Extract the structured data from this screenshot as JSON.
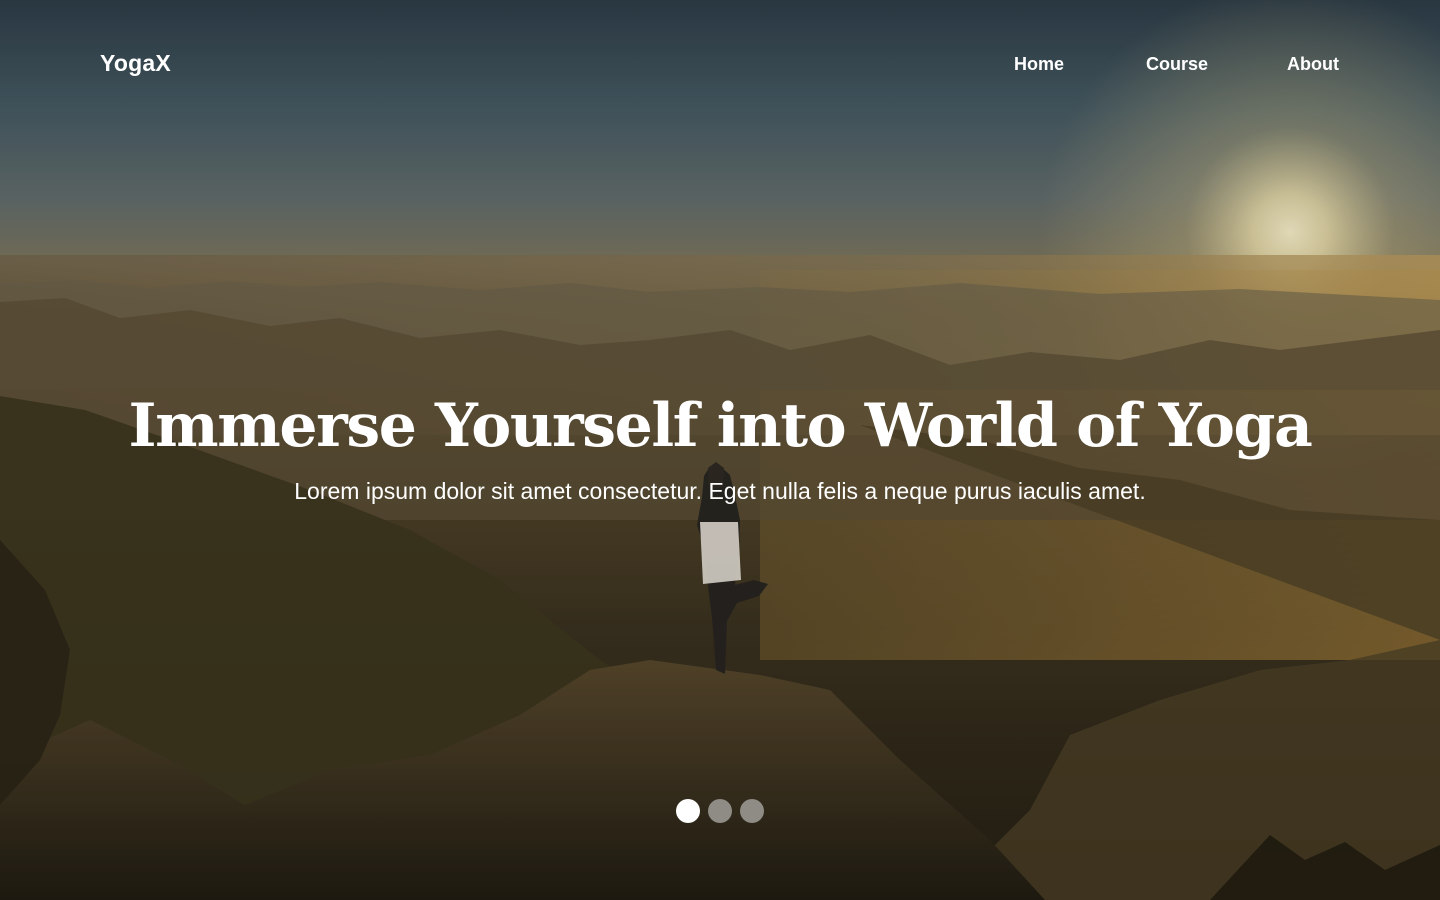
{
  "brand": {
    "name": "YogaX"
  },
  "nav": {
    "items": [
      {
        "label": "Home"
      },
      {
        "label": "Course"
      },
      {
        "label": "About"
      }
    ]
  },
  "hero": {
    "headline": "Immerse Yourself into World of Yoga",
    "subheadline": "Lorem ipsum dolor sit amet consectetur. Eget nulla felis a neque purus iaculis amet.",
    "background_scene": "sunset-mountain-yoga-photo"
  },
  "carousel": {
    "count": 3,
    "active_index": 1,
    "active_color": "#ffffff",
    "inactive_color": "#8f8c86"
  },
  "colors": {
    "text": "#ffffff",
    "sky_top": "#2f3f4a",
    "sun_glow": "#fff3c4"
  }
}
